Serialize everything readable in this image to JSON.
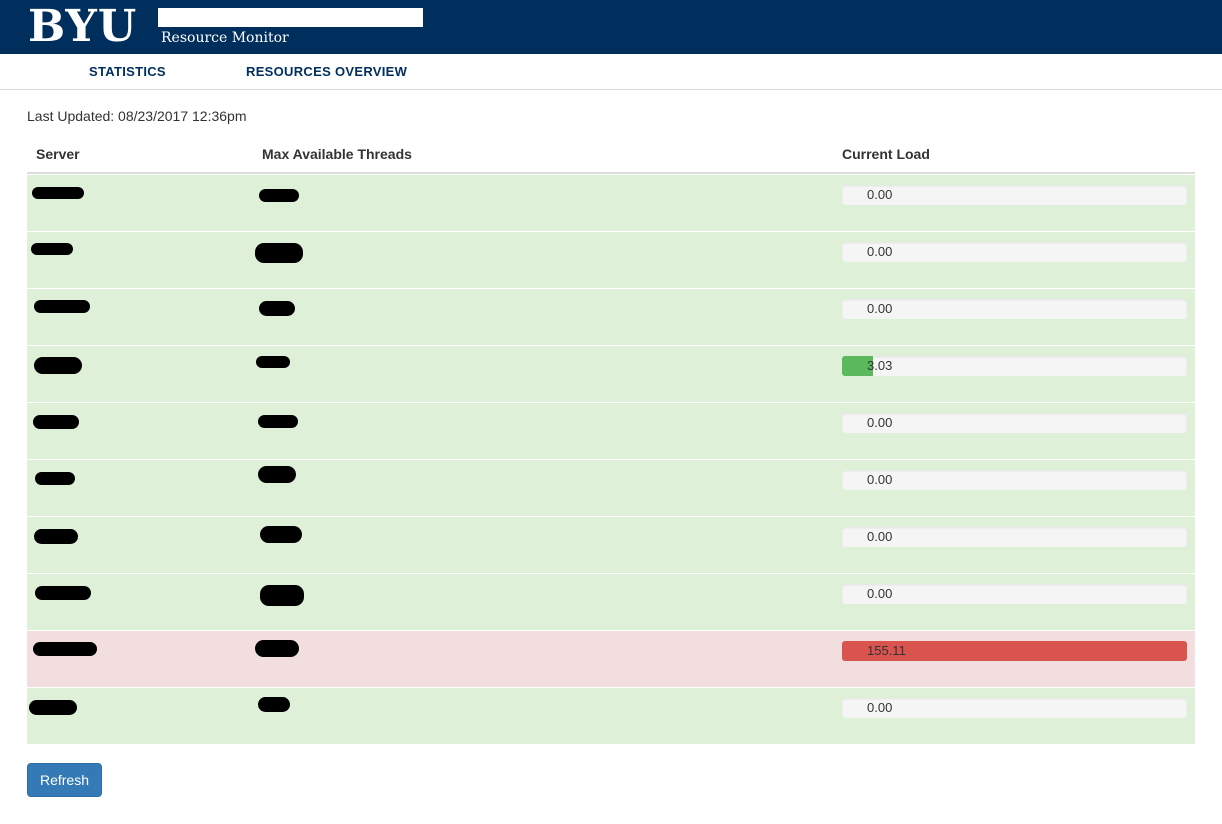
{
  "header": {
    "logo": "BYU",
    "subtitle": "Resource Monitor",
    "background_color": "#002e5d"
  },
  "nav": {
    "items": [
      {
        "label": "STATISTICS"
      },
      {
        "label": "RESOURCES OVERVIEW"
      }
    ]
  },
  "status": {
    "last_updated": "Last Updated: 08/23/2017 12:36pm"
  },
  "table": {
    "columns": [
      "Server",
      "Max Available Threads",
      "Current Load"
    ],
    "rows": [
      {
        "load": "0.00",
        "load_fraction": 0.0,
        "state": "success"
      },
      {
        "load": "0.00",
        "load_fraction": 0.0,
        "state": "success"
      },
      {
        "load": "0.00",
        "load_fraction": 0.0,
        "state": "success"
      },
      {
        "load": "3.03",
        "load_fraction": 0.09,
        "state": "success"
      },
      {
        "load": "0.00",
        "load_fraction": 0.0,
        "state": "success"
      },
      {
        "load": "0.00",
        "load_fraction": 0.0,
        "state": "success"
      },
      {
        "load": "0.00",
        "load_fraction": 0.0,
        "state": "success"
      },
      {
        "load": "0.00",
        "load_fraction": 0.0,
        "state": "success"
      },
      {
        "load": "155.11",
        "load_fraction": 1.0,
        "state": "danger"
      },
      {
        "load": "0.00",
        "load_fraction": 0.0,
        "state": "success"
      }
    ]
  },
  "colors": {
    "row_success": "#dff0d8",
    "row_danger": "#f2dede",
    "bar_success": "#5cb85c",
    "bar_danger": "#d9534f",
    "accent": "#337ab7"
  },
  "actions": {
    "refresh_label": "Refresh"
  }
}
